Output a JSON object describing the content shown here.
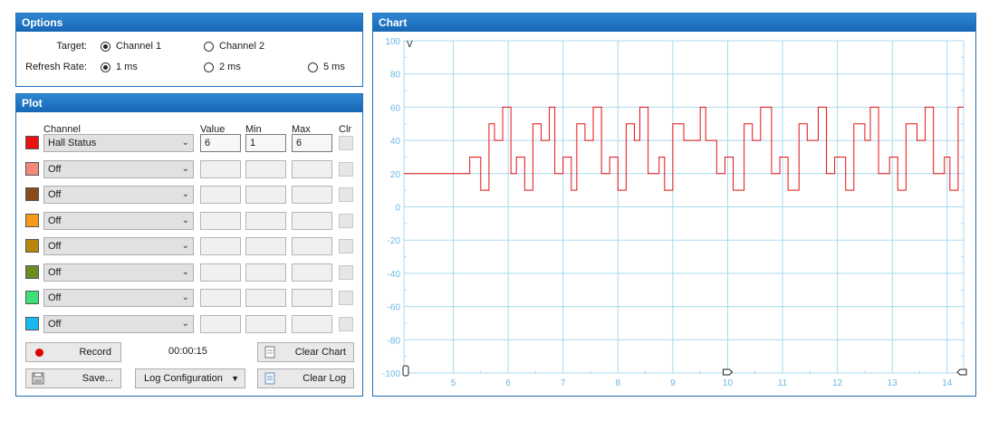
{
  "options": {
    "title": "Options",
    "target_label": "Target:",
    "refresh_label": "Refresh Rate:",
    "target_options": [
      "Channel 1",
      "Channel 2"
    ],
    "target_selected": "Channel 1",
    "refresh_options": [
      "1 ms",
      "2 ms",
      "5 ms"
    ],
    "refresh_selected": "1 ms"
  },
  "plot": {
    "title": "Plot",
    "headers": {
      "channel": "Channel",
      "value": "Value",
      "min": "Min",
      "max": "Max",
      "clr": "Clr"
    },
    "rows": [
      {
        "color": "#e81010",
        "channel": "Hall Status",
        "value": "6",
        "min": "1",
        "max": "6"
      },
      {
        "color": "#f58a7c",
        "channel": "Off",
        "value": "",
        "min": "",
        "max": ""
      },
      {
        "color": "#8a4b1a",
        "channel": "Off",
        "value": "",
        "min": "",
        "max": ""
      },
      {
        "color": "#f79a1a",
        "channel": "Off",
        "value": "",
        "min": "",
        "max": ""
      },
      {
        "color": "#b8860b",
        "channel": "Off",
        "value": "",
        "min": "",
        "max": ""
      },
      {
        "color": "#6b8e23",
        "channel": "Off",
        "value": "",
        "min": "",
        "max": ""
      },
      {
        "color": "#3ee07a",
        "channel": "Off",
        "value": "",
        "min": "",
        "max": ""
      },
      {
        "color": "#1ab8f0",
        "channel": "Off",
        "value": "",
        "min": "",
        "max": ""
      }
    ],
    "record_label": "Record",
    "timer": "00:00:15",
    "clear_chart_label": "Clear Chart",
    "save_label": "Save...",
    "log_config_label": "Log Configuration",
    "clear_log_label": "Clear Log"
  },
  "chart": {
    "title": "Chart",
    "y_marker": "V"
  },
  "chart_data": {
    "type": "line",
    "xlim": [
      4.1,
      14.3
    ],
    "ylim": [
      -100,
      100
    ],
    "x_ticks": [
      5,
      6,
      7,
      8,
      9,
      10,
      11,
      12,
      13,
      14
    ],
    "y_ticks": [
      100,
      80,
      60,
      40,
      20,
      0,
      -20,
      -40,
      -60,
      -80,
      -100
    ],
    "grid": true,
    "series": [
      {
        "color": "#e81010",
        "step_x": [
          4.1,
          5.3,
          5.5,
          5.65,
          5.75,
          5.9,
          6.05,
          6.15,
          6.3,
          6.45,
          6.6,
          6.75,
          6.85,
          7.0,
          7.15,
          7.25,
          7.4,
          7.55,
          7.7,
          7.85,
          8.0,
          8.15,
          8.3,
          8.4,
          8.55,
          8.75,
          8.85,
          9.0,
          9.2,
          9.5,
          9.6,
          9.8,
          9.95,
          10.1,
          10.3,
          10.45,
          10.6,
          10.8,
          10.95,
          11.1,
          11.3,
          11.45,
          11.65,
          11.8,
          11.95,
          12.15,
          12.3,
          12.5,
          12.6,
          12.75,
          12.95,
          13.1,
          13.25,
          13.45,
          13.6,
          13.75,
          13.95,
          14.05,
          14.2,
          14.3
        ],
        "step_y": [
          20,
          30,
          10,
          50,
          40,
          60,
          20,
          30,
          10,
          50,
          40,
          60,
          20,
          30,
          10,
          50,
          40,
          60,
          20,
          30,
          10,
          50,
          40,
          60,
          20,
          30,
          10,
          50,
          40,
          60,
          40,
          20,
          30,
          10,
          50,
          40,
          60,
          20,
          30,
          10,
          50,
          40,
          60,
          20,
          30,
          10,
          50,
          40,
          60,
          20,
          30,
          10,
          50,
          40,
          60,
          20,
          30,
          10,
          60,
          60
        ]
      }
    ]
  }
}
